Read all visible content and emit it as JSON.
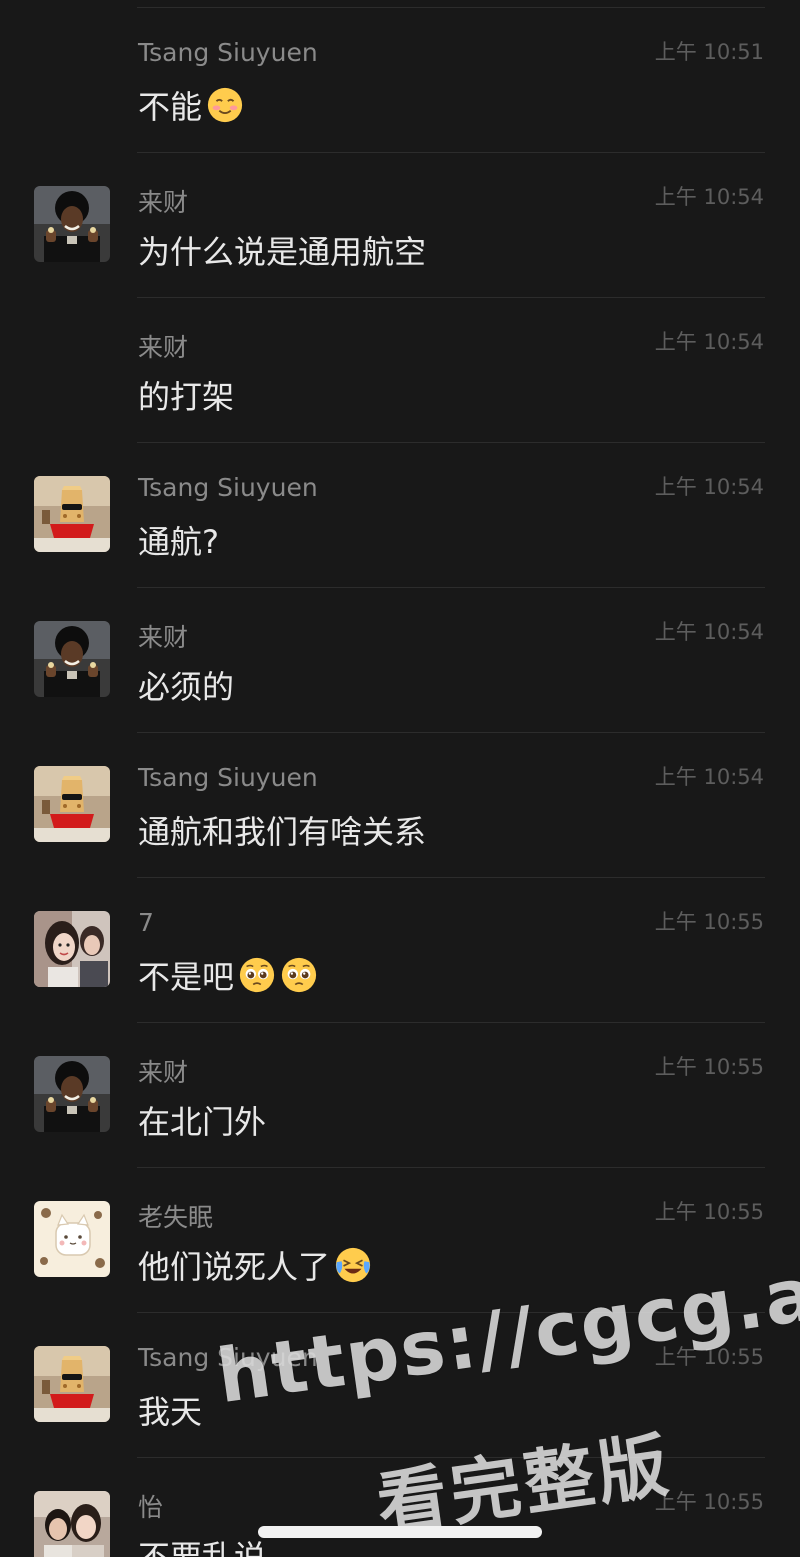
{
  "messages": [
    {
      "sender": "Tsang Siuyuen",
      "time": "上午 10:51",
      "text": "不能",
      "emoji": [
        "blush-emoji"
      ],
      "avatar": "none"
    },
    {
      "sender": "来财",
      "time": "上午 10:54",
      "text": "为什么说是通用航空",
      "emoji": [],
      "avatar": "laicai-avatar"
    },
    {
      "sender": "来财",
      "time": "上午 10:54",
      "text": "的打架",
      "emoji": [],
      "avatar": "none"
    },
    {
      "sender": "Tsang Siuyuen",
      "time": "上午 10:54",
      "text": "通航?",
      "emoji": [],
      "avatar": "tsang-avatar"
    },
    {
      "sender": "来财",
      "time": "上午 10:54",
      "text": "必须的",
      "emoji": [],
      "avatar": "laicai-avatar"
    },
    {
      "sender": "Tsang Siuyuen",
      "time": "上午 10:54",
      "text": "通航和我们有啥关系",
      "emoji": [],
      "avatar": "tsang-avatar"
    },
    {
      "sender": "7",
      "time": "上午 10:55",
      "text": "不是吧",
      "emoji": [
        "pleading-emoji",
        "pleading-emoji"
      ],
      "avatar": "seven-avatar"
    },
    {
      "sender": "来财",
      "time": "上午 10:55",
      "text": "在北门外",
      "emoji": [],
      "avatar": "laicai-avatar"
    },
    {
      "sender": "老失眠",
      "time": "上午 10:55",
      "text": "他们说死人了",
      "emoji": [
        "laugh-cry-emoji"
      ],
      "avatar": "laoshimian-avatar"
    },
    {
      "sender": "Tsang Siuyuen",
      "time": "上午 10:55",
      "text": "我天",
      "emoji": [],
      "avatar": "tsang-avatar"
    },
    {
      "sender": "怡",
      "time": "上午 10:55",
      "text": "不要乱说",
      "emoji": [],
      "avatar": "yi-avatar"
    }
  ],
  "watermark": {
    "url": "https://cgcg.app",
    "caption": "看完整版"
  },
  "colors": {
    "background": "#181818",
    "sender": "#8a8a8a",
    "text": "#e8e8e8",
    "time": "#5d5d5d",
    "divider": "#2c2c2c"
  }
}
